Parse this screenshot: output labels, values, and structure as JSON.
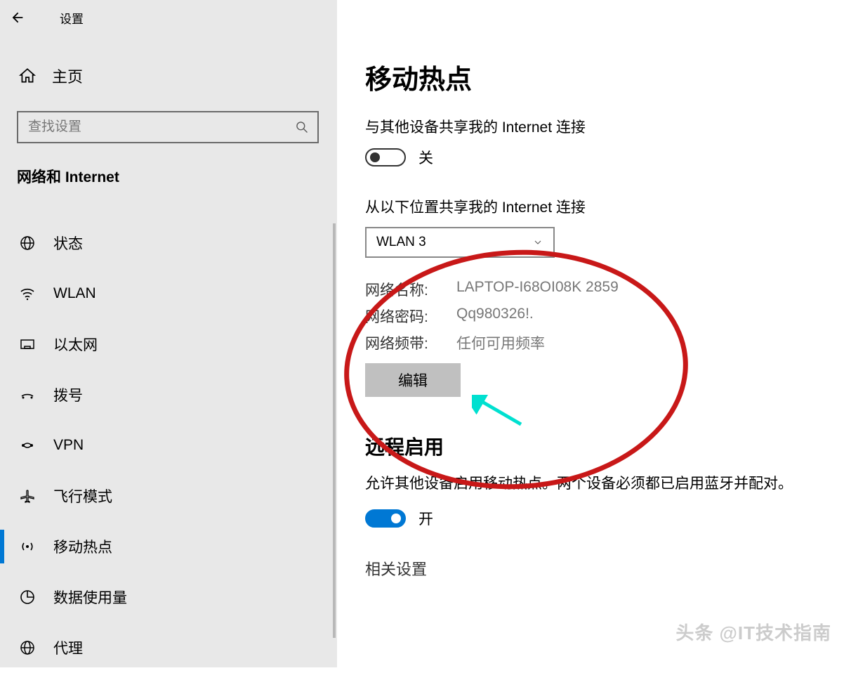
{
  "app_title": "设置",
  "home_label": "主页",
  "search_placeholder": "查找设置",
  "category": "网络和 Internet",
  "nav": [
    {
      "label": "状态",
      "icon": "globe"
    },
    {
      "label": "WLAN",
      "icon": "wifi"
    },
    {
      "label": "以太网",
      "icon": "ethernet"
    },
    {
      "label": "拨号",
      "icon": "dialup"
    },
    {
      "label": "VPN",
      "icon": "vpn"
    },
    {
      "label": "飞行模式",
      "icon": "airplane"
    },
    {
      "label": "移动热点",
      "icon": "hotspot",
      "active": true
    },
    {
      "label": "数据使用量",
      "icon": "data"
    },
    {
      "label": "代理",
      "icon": "proxy"
    }
  ],
  "page_title": "移动热点",
  "share_label": "与其他设备共享我的 Internet 连接",
  "share_toggle": {
    "on": false,
    "text": "关"
  },
  "from_label": "从以下位置共享我的 Internet 连接",
  "from_value": "WLAN 3",
  "info": {
    "name_k": "网络名称:",
    "name_v": "LAPTOP-I68OI08K 2859",
    "pwd_k": "网络密码:",
    "pwd_v": "Qq980326!.",
    "band_k": "网络频带:",
    "band_v": "任何可用频率"
  },
  "edit_label": "编辑",
  "remote_heading": "远程启用",
  "remote_desc": "允许其他设备启用移动热点。两个设备必须都已启用蓝牙并配对。",
  "remote_toggle": {
    "on": true,
    "text": "开"
  },
  "related_heading": "相关设置",
  "watermark": "头条 @IT技术指南"
}
